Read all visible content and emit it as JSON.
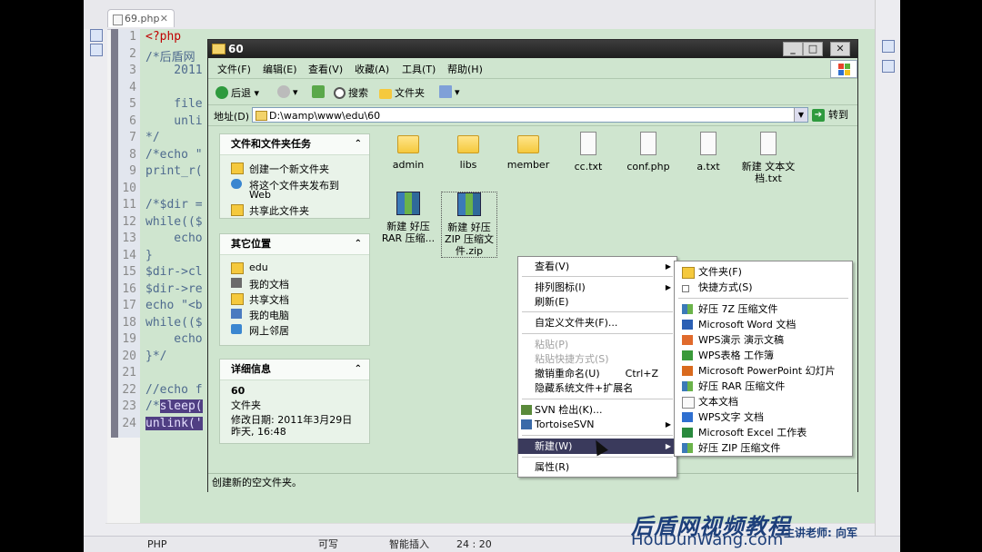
{
  "ide": {
    "tab_label": "69.php",
    "tab_close": "✕",
    "line_numbers": [
      "1",
      "2",
      "3",
      "4",
      "5",
      "6",
      "7",
      "8",
      "9",
      "10",
      "11",
      "12",
      "13",
      "14",
      "15",
      "16",
      "17",
      "18",
      "19",
      "20",
      "21",
      "22",
      "23",
      "24"
    ],
    "code_lines": [
      "<?php",
      "/*后盾网",
      "    2011",
      "",
      "    file",
      "    unli",
      "*/",
      "/*echo \"",
      "print_r(",
      "",
      "/*$dir =",
      "while(($",
      "    echo",
      "}",
      "$dir->cl",
      "$dir->re",
      "echo \"<b",
      "while(($",
      "    echo",
      "}*/",
      "",
      "//echo f",
      "/*sleep(",
      "unlink('"
    ],
    "status": {
      "lang": "PHP",
      "writable": "可写",
      "insert_mode": "智能插入",
      "position": "24 : 20"
    }
  },
  "window": {
    "title": "60",
    "menu": [
      "文件(F)",
      "编辑(E)",
      "查看(V)",
      "收藏(A)",
      "工具(T)",
      "帮助(H)"
    ],
    "toolbar": {
      "back": "后退",
      "search": "搜索",
      "folders": "文件夹"
    },
    "address_label": "地址(D)",
    "address_value": "D:\\wamp\\www\\edu\\60",
    "goto": "转到",
    "tasks_panel": {
      "title": "文件和文件夹任务",
      "items": [
        "创建一个新文件夹",
        "将这个文件夹发布到",
        "Web",
        "共享此文件夹"
      ]
    },
    "places_panel": {
      "title": "其它位置",
      "items": [
        "edu",
        "我的文档",
        "共享文档",
        "我的电脑",
        "网上邻居"
      ]
    },
    "details_panel": {
      "title": "详细信息",
      "name": "60",
      "type": "文件夹",
      "modified": "修改日期: 2011年3月29日",
      "time": "昨天, 16:48"
    },
    "files": [
      {
        "name": "admin",
        "kind": "folder"
      },
      {
        "name": "libs",
        "kind": "folder"
      },
      {
        "name": "member",
        "kind": "folder"
      },
      {
        "name": "cc.txt",
        "kind": "doc"
      },
      {
        "name": "conf.php",
        "kind": "doc"
      },
      {
        "name": "a.txt",
        "kind": "doc"
      },
      {
        "name": "新建 文本文",
        "name2": "档.txt",
        "kind": "doc"
      },
      {
        "name": "新建 好压",
        "name2": "RAR 压缩...",
        "kind": "zip"
      },
      {
        "name": "新建 好压",
        "name2": "ZIP 压缩文",
        "name3": "件.zip",
        "kind": "zip"
      }
    ],
    "status": "创建新的空文件夹。"
  },
  "context_menu": {
    "items": [
      "查看(V)",
      "排列图标(I)",
      "刷新(E)",
      "自定义文件夹(F)...",
      "粘贴(P)",
      "粘贴快捷方式(S)",
      "撤销重命名(U)",
      "隐藏系统文件+扩展名",
      "SVN 检出(K)...",
      "TortoiseSVN",
      "新建(W)",
      "属性(R)"
    ],
    "undo_shortcut": "Ctrl+Z",
    "arrow": "▶"
  },
  "submenu": {
    "items": [
      "文件夹(F)",
      "快捷方式(S)",
      "好压 7Z 压缩文件",
      "Microsoft Word 文档",
      "WPS演示 演示文稿",
      "WPS表格 工作簿",
      "Microsoft PowerPoint 幻灯片",
      "好压 RAR 压缩文件",
      "文本文档",
      "WPS文字 文档",
      "Microsoft Excel 工作表",
      "好压 ZIP 压缩文件"
    ]
  },
  "watermark": {
    "brand": "后盾网视频教程",
    "url": "HouDunWang.com",
    "teacher": "主讲老师: 向军"
  },
  "colors": {
    "window_bg": "#cfe5cf",
    "selection": "#3a3a5c",
    "code_highlight": "#503f83"
  }
}
